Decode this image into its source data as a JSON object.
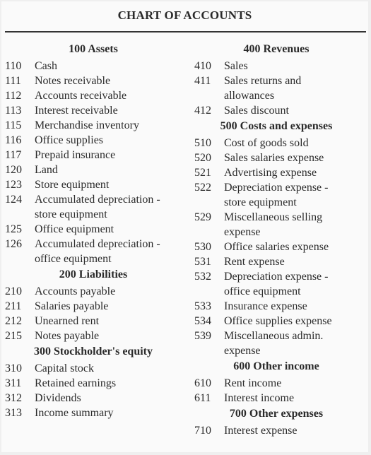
{
  "title": "CHART OF ACCOUNTS",
  "left_column": [
    {
      "heading": "100 Assets",
      "accounts": [
        {
          "number": "110",
          "name": "Cash"
        },
        {
          "number": "111",
          "name": "Notes receivable"
        },
        {
          "number": "112",
          "name": "Accounts receivable"
        },
        {
          "number": "113",
          "name": "Interest receivable"
        },
        {
          "number": "115",
          "name": "Merchandise inventory"
        },
        {
          "number": "116",
          "name": "Office supplies"
        },
        {
          "number": "117",
          "name": "Prepaid insurance"
        },
        {
          "number": "120",
          "name": "Land"
        },
        {
          "number": "123",
          "name": "Store equipment"
        },
        {
          "number": "124",
          "name": "Accumulated depreciation - store equipment"
        },
        {
          "number": "125",
          "name": "Office equipment"
        },
        {
          "number": "126",
          "name": "Accumulated depreciation - office equipment"
        }
      ]
    },
    {
      "heading": "200 Liabilities",
      "accounts": [
        {
          "number": "210",
          "name": "Accounts payable"
        },
        {
          "number": "211",
          "name": "Salaries payable"
        },
        {
          "number": "212",
          "name": "Unearned rent"
        },
        {
          "number": "215",
          "name": "Notes payable"
        }
      ]
    },
    {
      "heading": "300 Stockholder's equity",
      "accounts": [
        {
          "number": "310",
          "name": "Capital stock"
        },
        {
          "number": "311",
          "name": "Retained earnings"
        },
        {
          "number": "312",
          "name": "Dividends"
        },
        {
          "number": "313",
          "name": "Income summary"
        }
      ]
    }
  ],
  "right_column": [
    {
      "heading": "400 Revenues",
      "accounts": [
        {
          "number": "410",
          "name": "Sales"
        },
        {
          "number": "411",
          "name": "Sales returns and allowances"
        },
        {
          "number": "412",
          "name": "Sales discount"
        }
      ]
    },
    {
      "heading": "500 Costs and expenses",
      "accounts": [
        {
          "number": "510",
          "name": "Cost of goods sold"
        },
        {
          "number": "520",
          "name": "Sales salaries expense"
        },
        {
          "number": "521",
          "name": "Advertising expense"
        },
        {
          "number": "522",
          "name": "Depreciation expense - store equipment"
        },
        {
          "number": "529",
          "name": "Miscellaneous selling expense"
        },
        {
          "number": "530",
          "name": "Office salaries expense"
        },
        {
          "number": "531",
          "name": "Rent expense"
        },
        {
          "number": "532",
          "name": "Depreciation expense - office equipment"
        },
        {
          "number": "533",
          "name": "Insurance expense"
        },
        {
          "number": "534",
          "name": "Office supplies expense"
        },
        {
          "number": "539",
          "name": "Miscellaneous admin. expense"
        }
      ]
    },
    {
      "heading": "600 Other income",
      "accounts": [
        {
          "number": "610",
          "name": "Rent income"
        },
        {
          "number": "611",
          "name": "Interest income"
        }
      ]
    },
    {
      "heading": "700 Other expenses",
      "accounts": [
        {
          "number": "710",
          "name": "Interest expense"
        }
      ]
    }
  ]
}
